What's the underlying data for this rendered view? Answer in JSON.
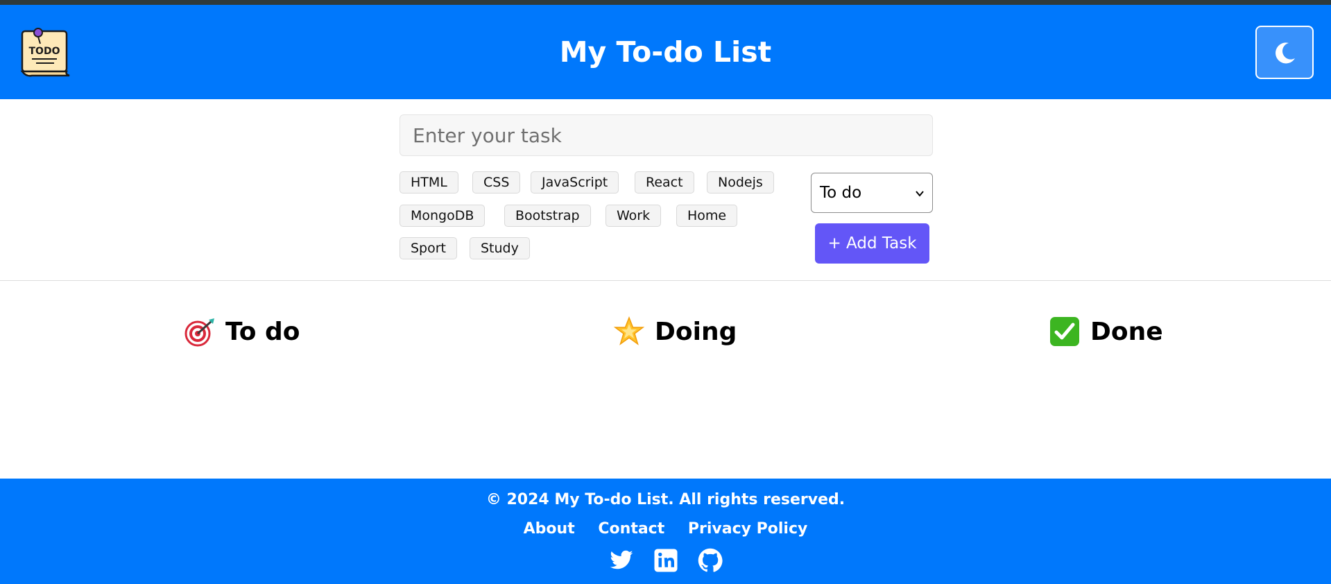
{
  "header": {
    "title": "My To-do List",
    "logo_text": "TODO",
    "theme_toggle_icon": "moon-icon"
  },
  "form": {
    "task_placeholder": "Enter your task",
    "tags": [
      "HTML",
      "CSS",
      "JavaScript",
      "React",
      "Nodejs",
      "MongoDB",
      "Bootstrap",
      "Work",
      "Home",
      "Sport",
      "Study"
    ],
    "status_selected": "To do",
    "add_button_label": "+ Add Task"
  },
  "columns": [
    {
      "title": "To do",
      "icon": "target-icon"
    },
    {
      "title": "Doing",
      "icon": "glowing-star-icon"
    },
    {
      "title": "Done",
      "icon": "check-mark-icon"
    }
  ],
  "footer": {
    "copyright": "© 2024 My To-do List. All rights reserved.",
    "links": [
      "About",
      "Contact",
      "Privacy Policy"
    ],
    "social_icons": [
      "twitter-icon",
      "linkedin-icon",
      "github-icon"
    ]
  },
  "colors": {
    "header_bg": "#0078fc",
    "add_button_bg": "#6356f7",
    "footer_bg": "#0078fc"
  }
}
